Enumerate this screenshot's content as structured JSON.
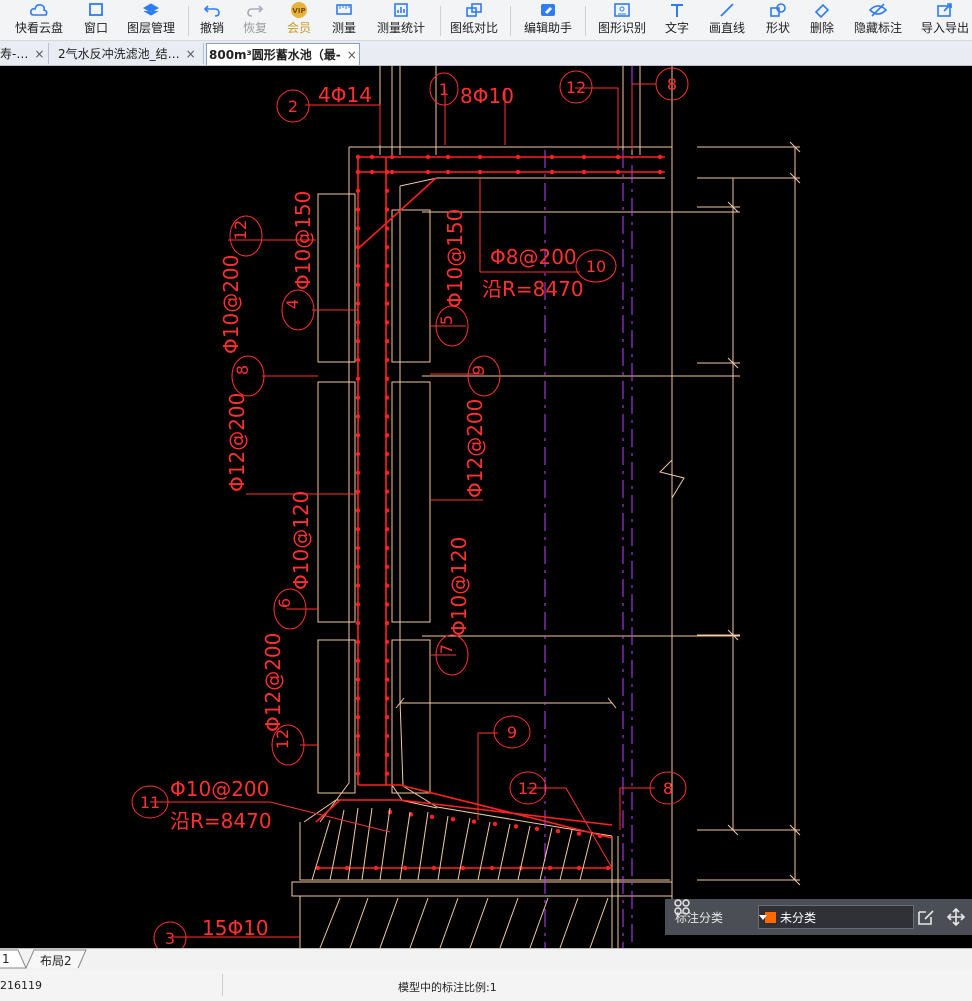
{
  "toolbar": {
    "buttons": [
      {
        "label": "快看云盘",
        "icon": "cloud-icon"
      },
      {
        "label": "窗口",
        "icon": "window-icon"
      },
      {
        "label": "图层管理",
        "icon": "layers-icon"
      },
      {
        "label": "撤销",
        "icon": "undo-icon"
      },
      {
        "label": "恢复",
        "icon": "redo-icon"
      },
      {
        "label": "会员",
        "icon": "vip-icon",
        "badge": "VIP"
      },
      {
        "label": "测量",
        "icon": "measure-icon"
      },
      {
        "label": "测量统计",
        "icon": "measure-stats-icon"
      },
      {
        "label": "图纸对比",
        "icon": "compare-icon"
      },
      {
        "label": "编辑助手",
        "icon": "edit-assistant-icon"
      },
      {
        "label": "图形识别",
        "icon": "shape-recognize-icon"
      },
      {
        "label": "文字",
        "icon": "text-icon"
      },
      {
        "label": "画直线",
        "icon": "line-icon"
      },
      {
        "label": "形状",
        "icon": "shape-icon"
      },
      {
        "label": "删除",
        "icon": "eraser-icon"
      },
      {
        "label": "隐藏标注",
        "icon": "hide-annotation-icon"
      },
      {
        "label": "导入导出",
        "icon": "import-export-icon"
      }
    ]
  },
  "tabs": [
    {
      "label": "寿-…",
      "close": "×"
    },
    {
      "label": "2气水反冲洗滤池_结…",
      "close": "×"
    },
    {
      "label": "800m³圆形蓄水池（最-",
      "close": "×",
      "active": true
    }
  ],
  "drawing": {
    "labels": {
      "t_4phi14": "4Φ14",
      "t_8phi10": "8Φ10",
      "t_phi10_150": "Φ10@150",
      "t_phi10_150b": "Φ10@150",
      "t_phi10_200": "Φ10@200",
      "t_phi8_200": "Φ8@200",
      "t_r8470": "沿R=8470",
      "t_phi12_200a": "Φ12@200",
      "t_phi12_200b": "Φ12@200",
      "t_phi10_120a": "Φ10@120",
      "t_phi10_120b": "Φ10@120",
      "t_phi12_200c": "Φ12@200",
      "t_phi10_200b": "Φ10@200",
      "t_r8470b": "沿R=8470",
      "t_15phi10": "15Φ10"
    },
    "markers": {
      "m2": "2",
      "m1": "1",
      "m12a": "12",
      "m8a": "8",
      "m12b": "12",
      "m10": "10",
      "m4": "4",
      "m5": "5",
      "m8b": "8",
      "m9a": "9",
      "m6": "6",
      "m7": "7",
      "m12c": "12",
      "m9b": "9",
      "m12d": "12",
      "m8c": "8",
      "m11": "11",
      "m3": "3"
    }
  },
  "annotation_panel": {
    "label": "标注分类",
    "selected": "未分类",
    "swatch_color": "#ff6a00",
    "icons": [
      "grid-icon",
      "chevron-down-icon",
      "edit-icon",
      "move-icon"
    ]
  },
  "layout_tabs": [
    "1",
    "布局2"
  ],
  "status": {
    "coords": "216119",
    "scale_text": "模型中的标注比例:1"
  },
  "colors": {
    "drawing_bg": "#000000",
    "rebar": "#ff2020",
    "outline": "#f2c9a0",
    "annotation": "#ff3030",
    "centerline": "#c040ff"
  }
}
